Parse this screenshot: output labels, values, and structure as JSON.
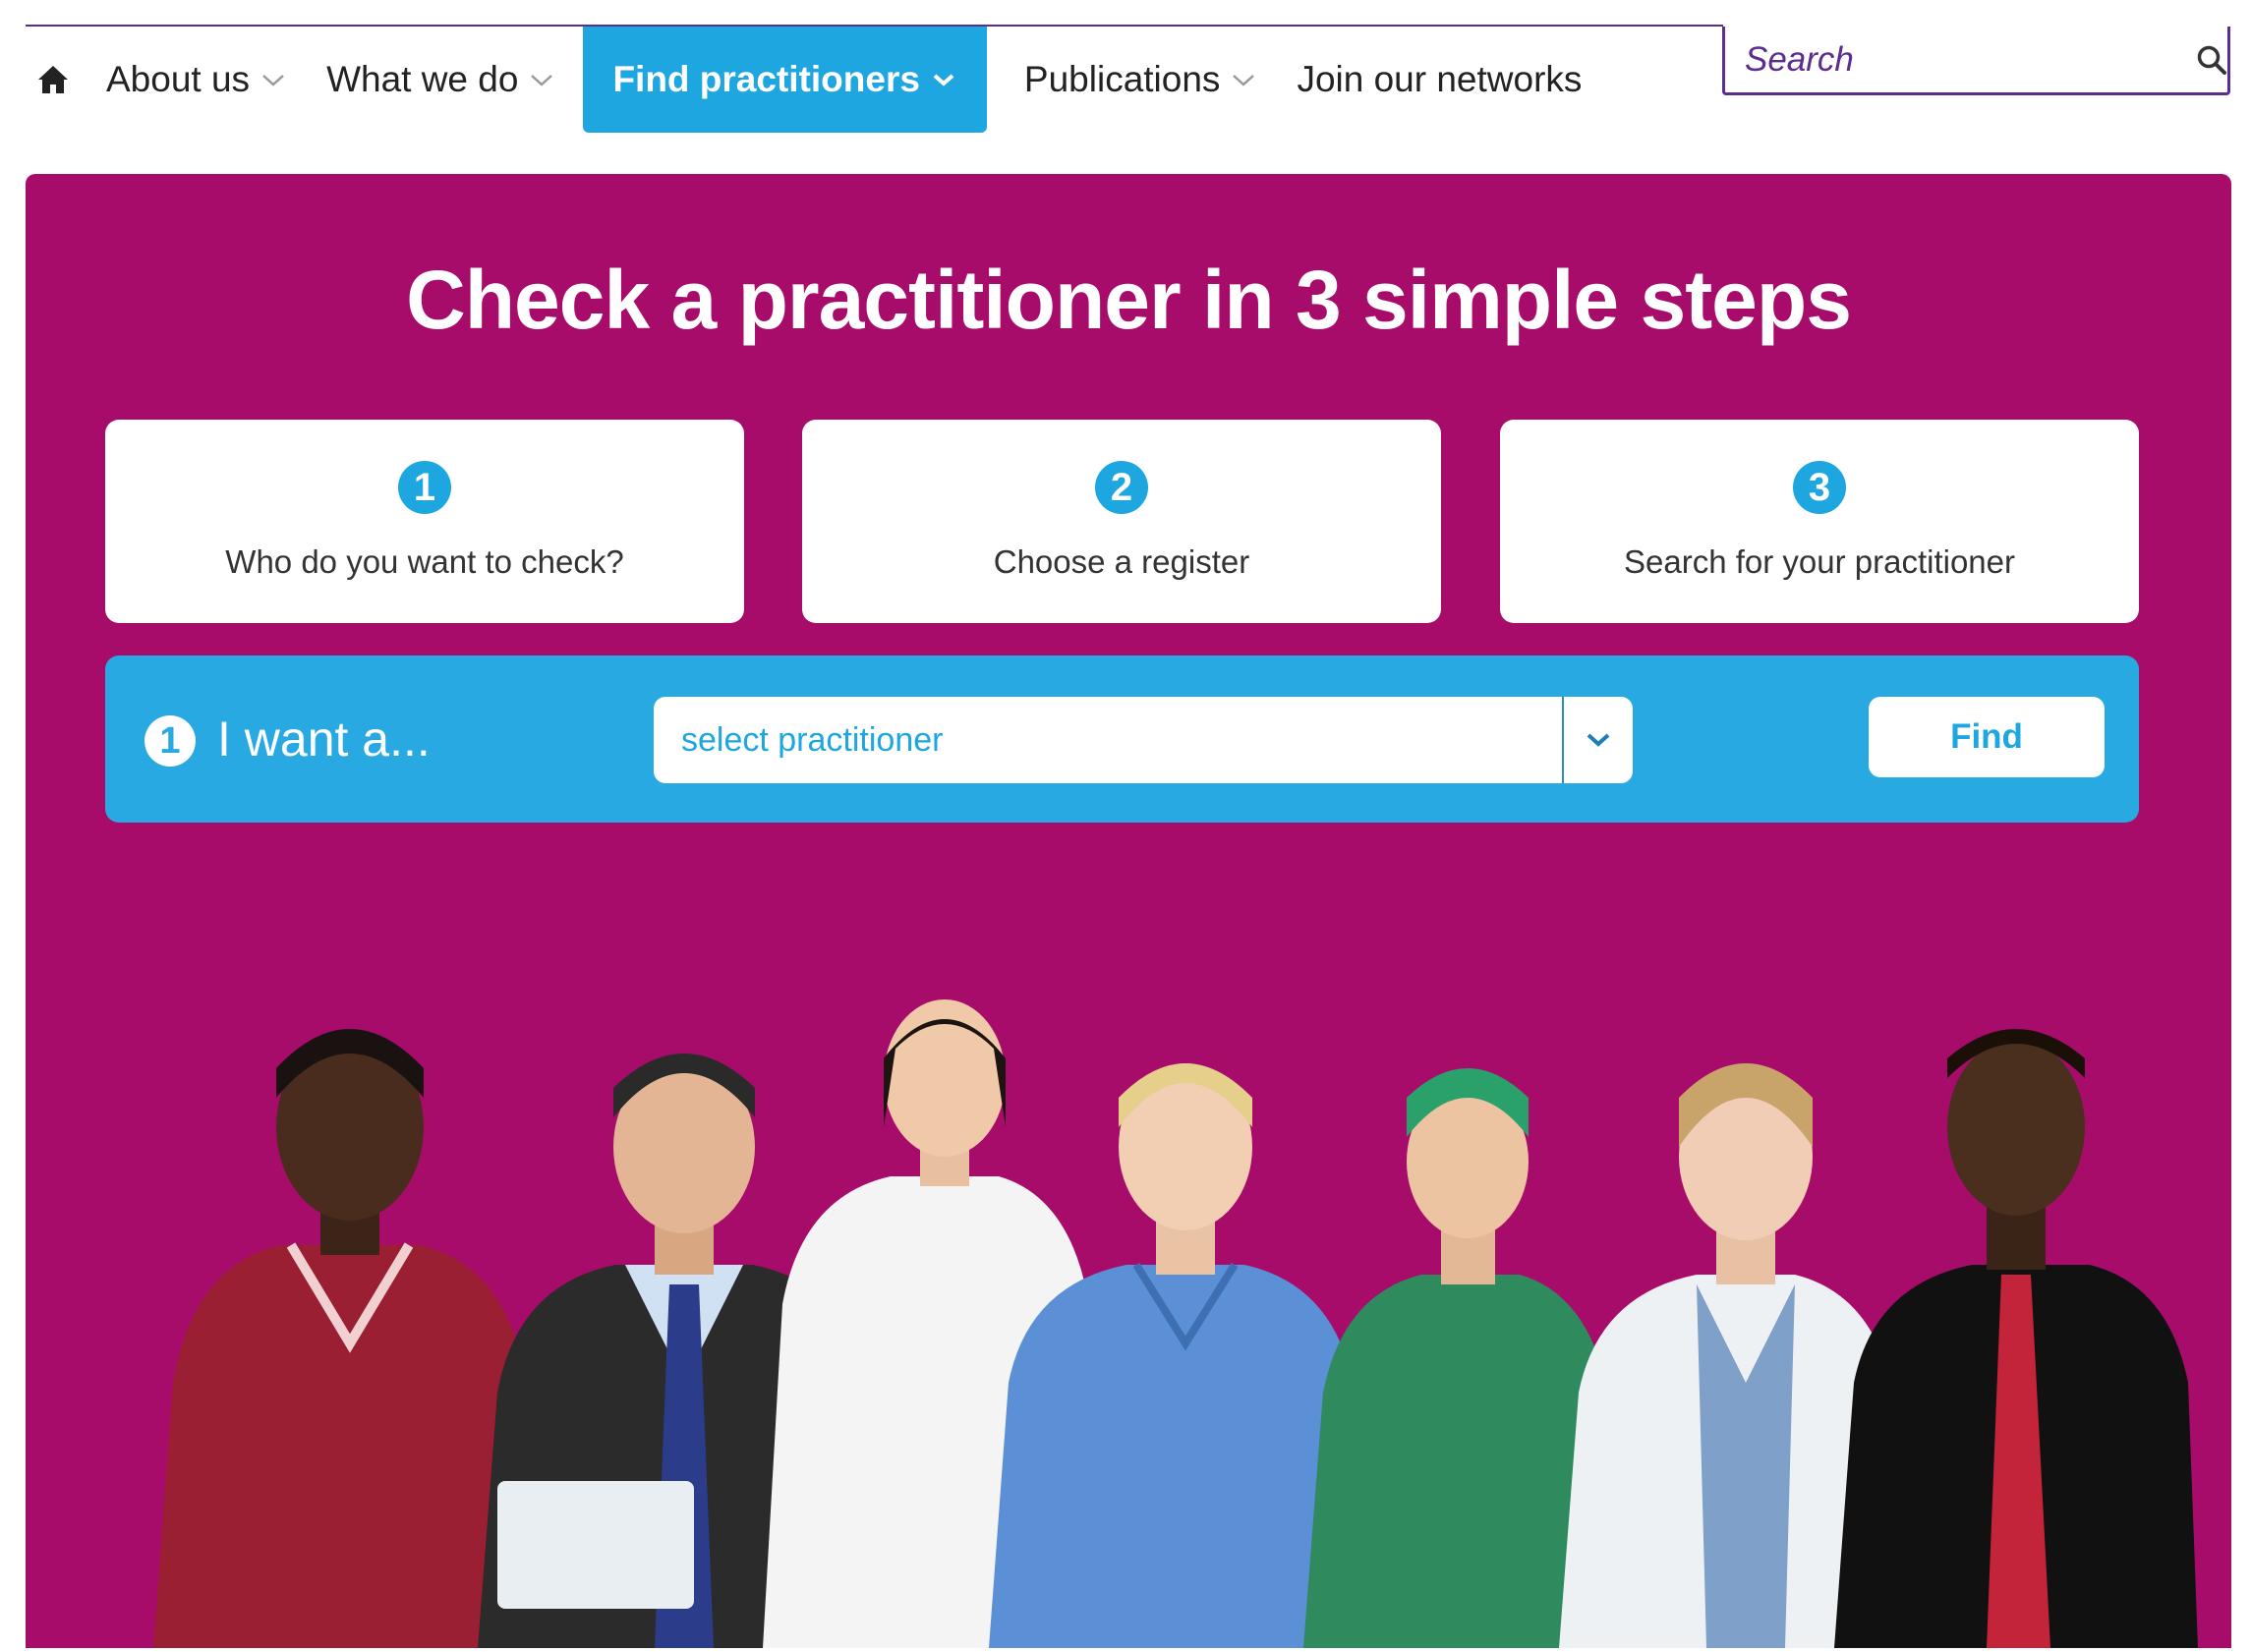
{
  "nav": {
    "items": [
      {
        "label": "About us",
        "has_dropdown": true,
        "active": false
      },
      {
        "label": "What we do",
        "has_dropdown": true,
        "active": false
      },
      {
        "label": "Find practitioners",
        "has_dropdown": true,
        "active": true
      },
      {
        "label": "Publications",
        "has_dropdown": true,
        "active": false
      },
      {
        "label": "Join our networks",
        "has_dropdown": false,
        "active": false
      }
    ],
    "home_icon": "home-icon"
  },
  "search": {
    "placeholder": "Search",
    "icon": "search-icon"
  },
  "hero": {
    "title": "Check a practitioner in 3 simple steps",
    "steps": [
      {
        "number": "1",
        "label": "Who do you want to check?"
      },
      {
        "number": "2",
        "label": "Choose a register"
      },
      {
        "number": "3",
        "label": "Search for your practitioner"
      }
    ],
    "selector": {
      "step_number": "1",
      "label": "I want a...",
      "select_value": "select practitioner",
      "find_label": "Find"
    }
  },
  "colors": {
    "hero_bg": "#a70c6b",
    "accent_blue": "#1ea6e1",
    "nav_border": "#5b2d8f"
  }
}
